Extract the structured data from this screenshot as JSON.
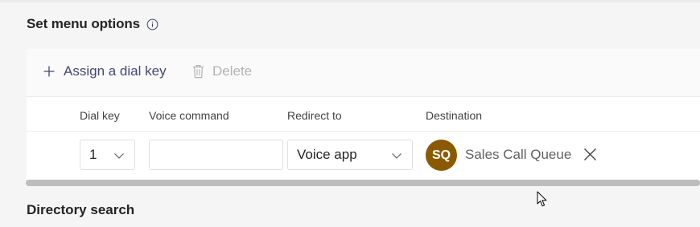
{
  "menu_options": {
    "title": "Set menu options",
    "info_icon": "info-icon",
    "toolbar": {
      "assign_label": "Assign a dial key",
      "assign_icon": "plus-icon",
      "delete_label": "Delete",
      "delete_icon": "trash-icon"
    },
    "columns": [
      "Dial key",
      "Voice command",
      "Redirect to",
      "Destination"
    ],
    "rows": [
      {
        "dial_key": "1",
        "voice_command": "",
        "redirect_to": "Voice app",
        "destination": {
          "initials": "SQ",
          "name": "Sales Call Queue",
          "avatar_color": "#8a5a00"
        }
      }
    ]
  },
  "directory_search": {
    "title": "Directory search"
  },
  "colors": {
    "accent": "#464775",
    "disabled": "#b3b3b3",
    "avatar": "#8a5a00"
  }
}
